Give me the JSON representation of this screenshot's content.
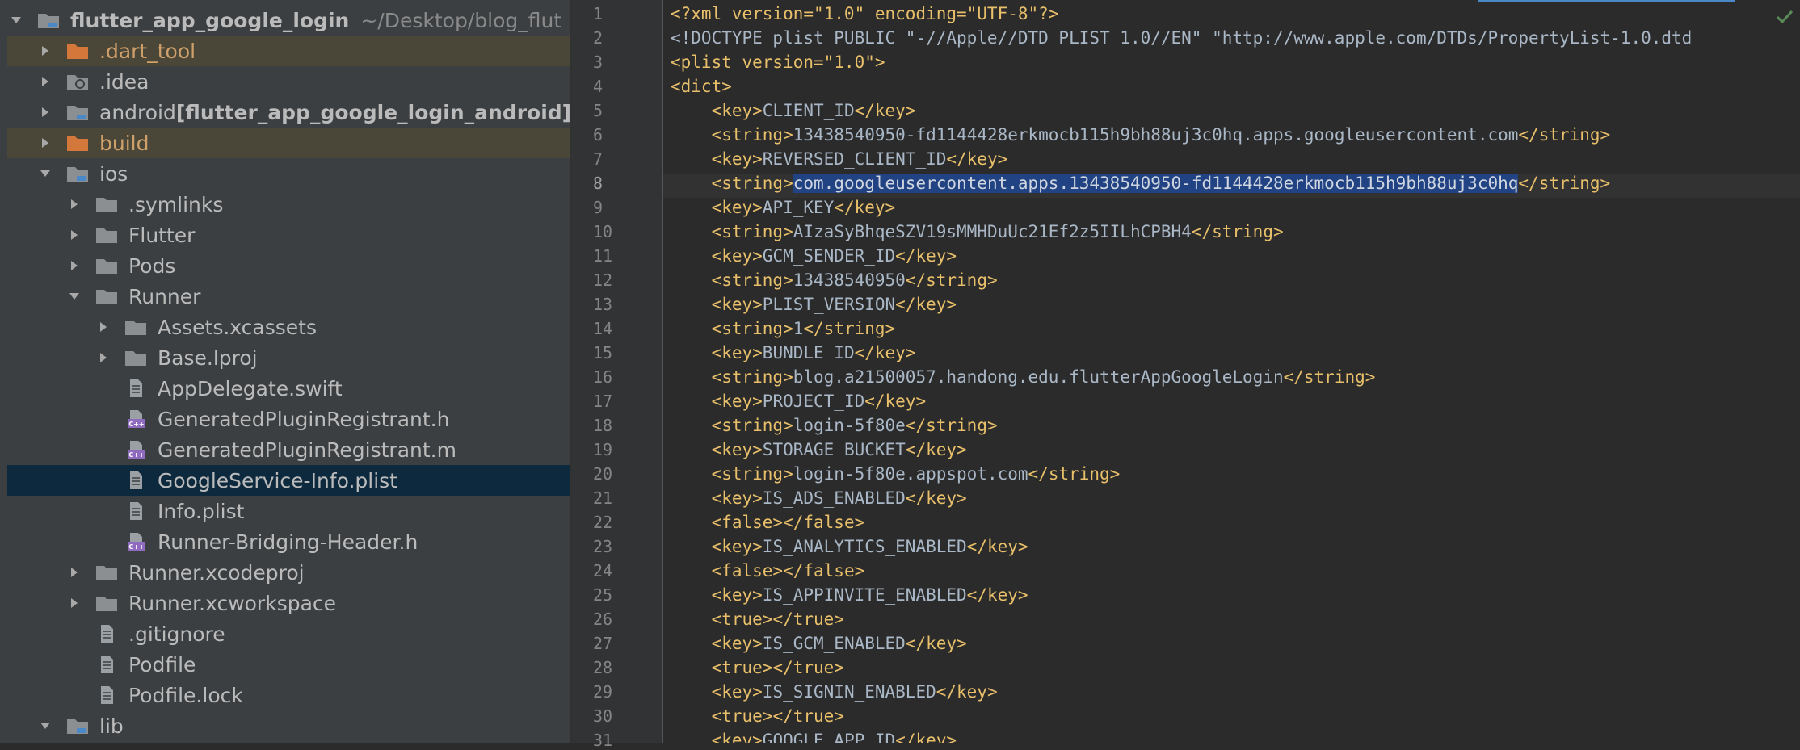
{
  "project_tree": {
    "root": {
      "name": "flutter_app_google_login",
      "path_hint": "~/Desktop/blog_flut"
    },
    "items": [
      {
        "label": "flutter_app_google_login",
        "depth": 0
      },
      {
        "label": ".dart_tool",
        "depth": 1
      },
      {
        "label": ".idea",
        "depth": 1
      },
      {
        "label": "android",
        "module": "[flutter_app_google_login_android]",
        "depth": 1
      },
      {
        "label": "build",
        "depth": 1
      },
      {
        "label": "ios",
        "depth": 1
      },
      {
        "label": ".symlinks",
        "depth": 2
      },
      {
        "label": "Flutter",
        "depth": 2
      },
      {
        "label": "Pods",
        "depth": 2
      },
      {
        "label": "Runner",
        "depth": 2
      },
      {
        "label": "Assets.xcassets",
        "depth": 3
      },
      {
        "label": "Base.lproj",
        "depth": 3
      },
      {
        "label": "AppDelegate.swift",
        "depth": 3
      },
      {
        "label": "GeneratedPluginRegistrant.h",
        "depth": 3
      },
      {
        "label": "GeneratedPluginRegistrant.m",
        "depth": 3
      },
      {
        "label": "GoogleService-Info.plist",
        "depth": 3
      },
      {
        "label": "Info.plist",
        "depth": 3
      },
      {
        "label": "Runner-Bridging-Header.h",
        "depth": 3
      },
      {
        "label": "Runner.xcodeproj",
        "depth": 2
      },
      {
        "label": "Runner.xcworkspace",
        "depth": 2
      },
      {
        "label": ".gitignore",
        "depth": 2
      },
      {
        "label": "Podfile",
        "depth": 2
      },
      {
        "label": "Podfile.lock",
        "depth": 2
      },
      {
        "label": "lib",
        "depth": 1
      }
    ],
    "icons": [
      "folder-icon",
      "orange-folder-icon",
      "settings-folder-icon",
      "file-icon",
      "cpp-header-icon"
    ],
    "selected_file": "GoogleService-Info.plist"
  },
  "editor": {
    "line_numbers": [
      "1",
      "2",
      "3",
      "4",
      "5",
      "6",
      "7",
      "8",
      "9",
      "10",
      "11",
      "12",
      "13",
      "14",
      "15",
      "16",
      "17",
      "18",
      "19",
      "20",
      "21",
      "22",
      "23",
      "24",
      "25",
      "26",
      "27",
      "28",
      "29",
      "30",
      "31"
    ],
    "lines": [
      "<?xml version=\"1.0\" encoding=\"UTF-8\"?>",
      "<!DOCTYPE plist PUBLIC \"-//Apple//DTD PLIST 1.0//EN\" \"http://www.apple.com/DTDs/PropertyList-1.0.dtd",
      "<plist version=\"1.0\">",
      "<dict>",
      "    <key>CLIENT_ID</key>",
      "    <string>13438540950-fd1144428erkmocb115h9bh88uj3c0hq.apps.googleusercontent.com</string>",
      "    <key>REVERSED_CLIENT_ID</key>",
      "    <string>com.googleusercontent.apps.13438540950-fd1144428erkmocb115h9bh88uj3c0hq</string>",
      "    <key>API_KEY</key>",
      "    <string>AIzaSyBhqeSZV19sMMHDuUc21Ef2z5IILhCPBH4</string>",
      "    <key>GCM_SENDER_ID</key>",
      "    <string>13438540950</string>",
      "    <key>PLIST_VERSION</key>",
      "    <string>1</string>",
      "    <key>BUNDLE_ID</key>",
      "    <string>blog.a21500057.handong.edu.flutterAppGoogleLogin</string>",
      "    <key>PROJECT_ID</key>",
      "    <string>login-5f80e</string>",
      "    <key>STORAGE_BUCKET</key>",
      "    <string>login-5f80e.appspot.com</string>",
      "    <key>IS_ADS_ENABLED</key>",
      "    <false></false>",
      "    <key>IS_ANALYTICS_ENABLED</key>",
      "    <false></false>",
      "    <key>IS_APPINVITE_ENABLED</key>",
      "    <true></true>",
      "    <key>IS_GCM_ENABLED</key>",
      "    <true></true>",
      "    <key>IS_SIGNIN_ENABLED</key>",
      "    <true></true>",
      "    <key>GOOGLE_APP_ID</key>"
    ],
    "selected_text": "com.googleusercontent.apps.13438540950-fd1144428erkmocb115h9bh88uj3c0hq",
    "current_line": "8"
  },
  "colors": {
    "sidebar_bg": "#3c3f41",
    "editor_bg": "#2b2b2b",
    "selection": "#214283",
    "tree_selection": "#0d293e",
    "excluded_bg": "#4a4739"
  }
}
